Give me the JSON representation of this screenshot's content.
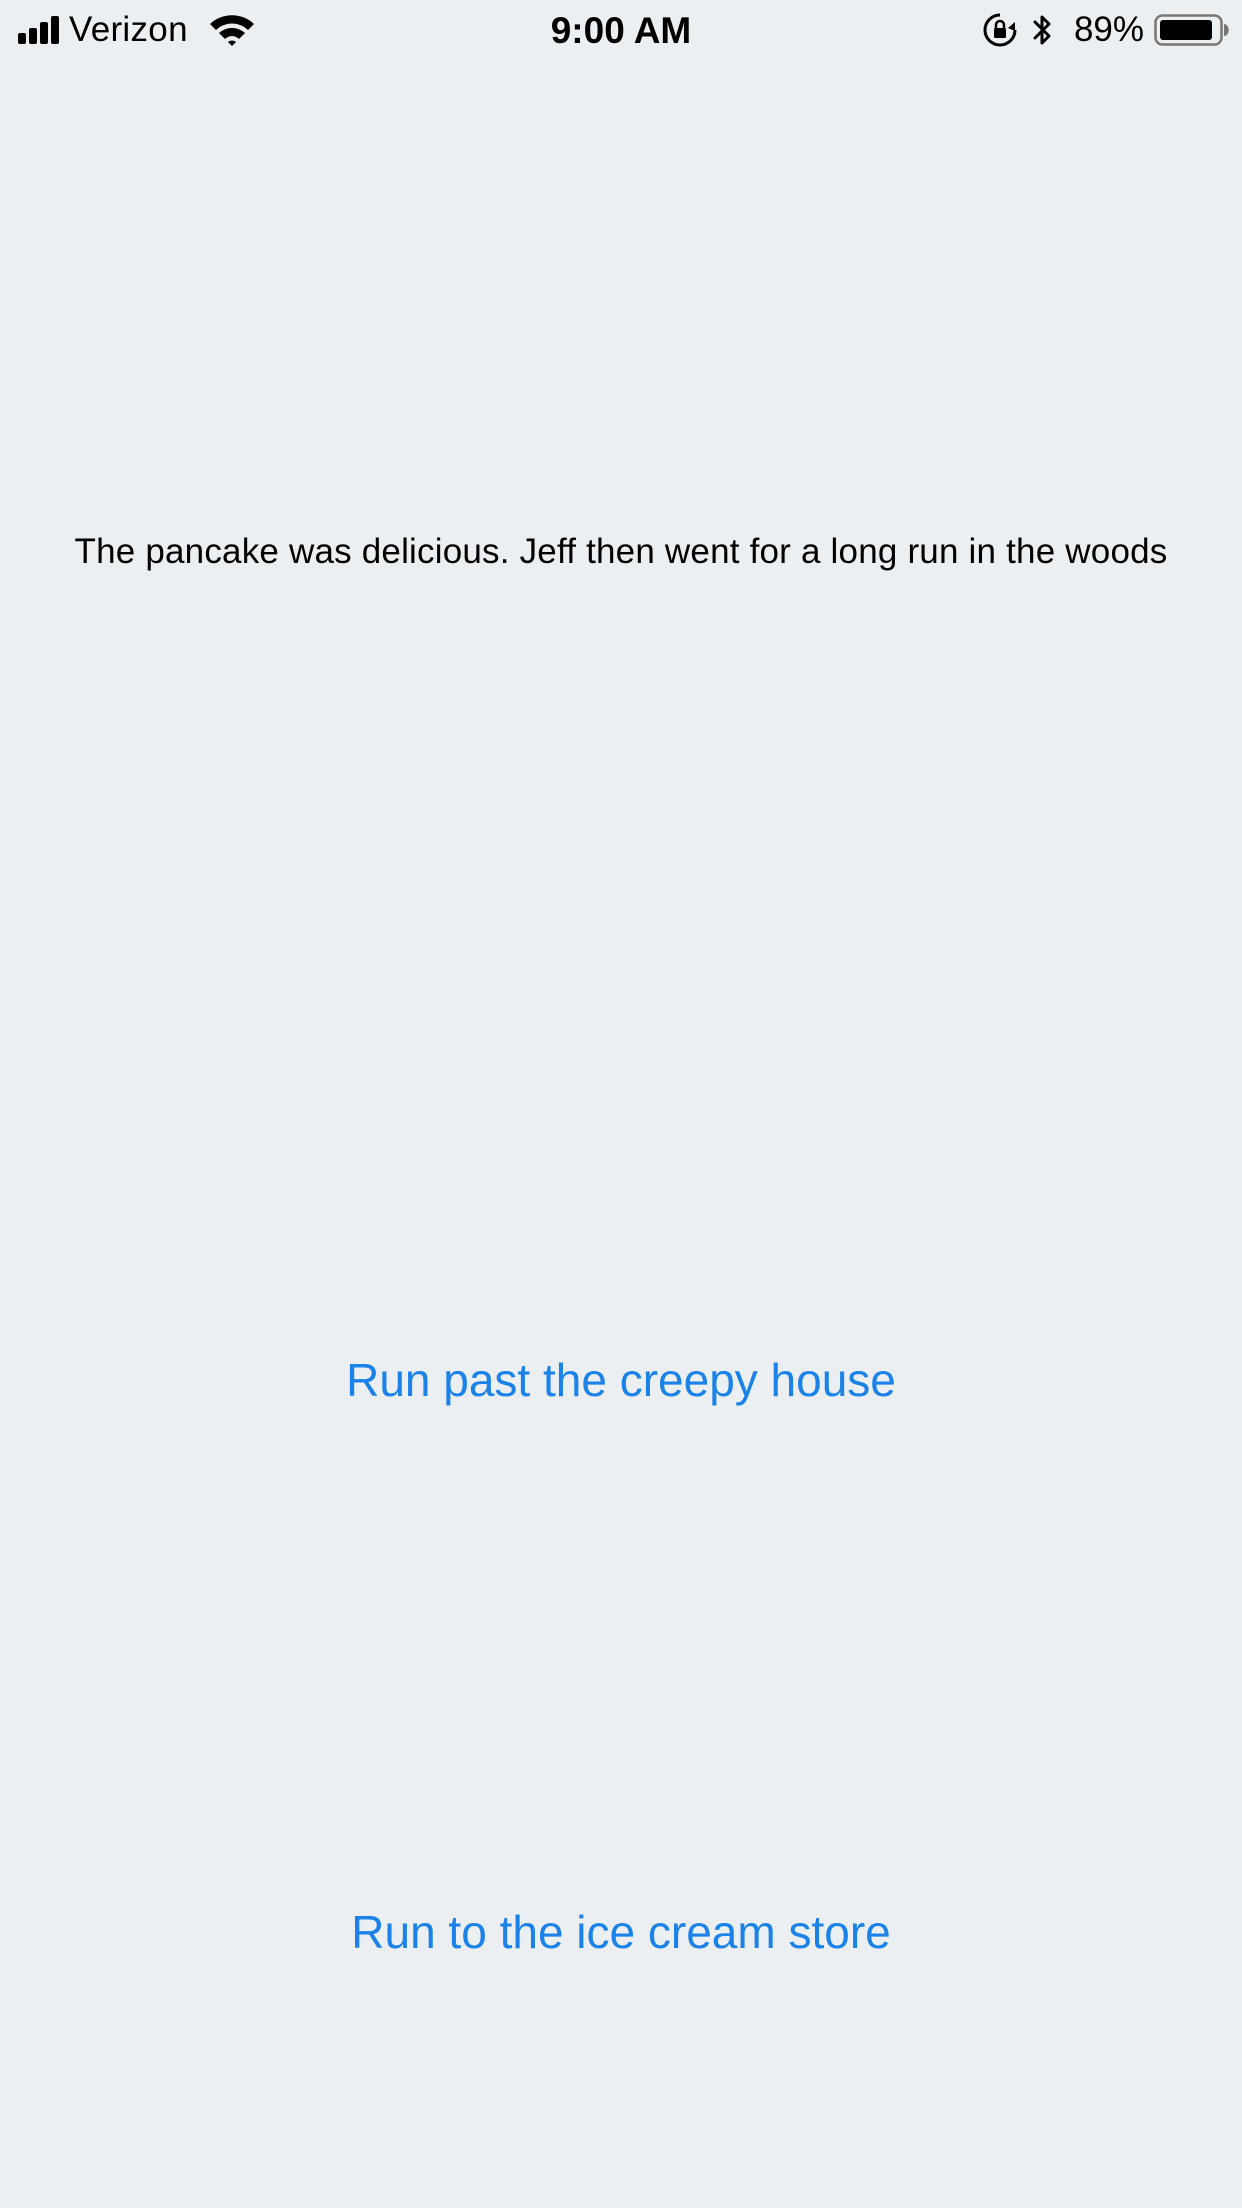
{
  "status_bar": {
    "carrier": "Verizon",
    "time": "9:00 AM",
    "battery_percent": "89%",
    "battery_level": 0.89,
    "signal_bars": 4,
    "icons": [
      "signal-icon",
      "wifi-icon",
      "rotation-lock-icon",
      "bluetooth-icon",
      "battery-icon"
    ]
  },
  "story": {
    "text": "The pancake was delicious. Jeff then went for a long run in the woods"
  },
  "choices": [
    {
      "label": "Run past the creepy house"
    },
    {
      "label": "Run to the ice cream store"
    }
  ],
  "colors": {
    "background": "#eceff1",
    "link_blue": "#1a82e8",
    "text": "#000000"
  }
}
